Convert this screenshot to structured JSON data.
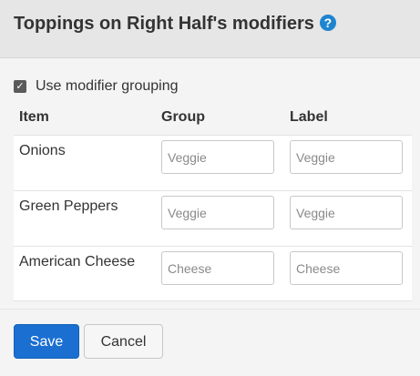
{
  "dialog": {
    "title": "Toppings on Right Half's modifiers",
    "help_icon": "?"
  },
  "grouping": {
    "checked": true,
    "label": "Use modifier grouping"
  },
  "table": {
    "headers": {
      "item": "Item",
      "group": "Group",
      "label": "Label"
    },
    "rows": [
      {
        "item": "Onions",
        "group_placeholder": "Veggie",
        "label_placeholder": "Veggie"
      },
      {
        "item": "Green Peppers",
        "group_placeholder": "Veggie",
        "label_placeholder": "Veggie"
      },
      {
        "item": "American Cheese",
        "group_placeholder": "Cheese",
        "label_placeholder": "Cheese"
      }
    ]
  },
  "actions": {
    "save_label": "Save",
    "cancel_label": "Cancel"
  },
  "colors": {
    "primary": "#1a6fd1",
    "help_icon": "#1e84d0",
    "header_bg": "#e6e6e6"
  },
  "icons": {
    "help": "help-icon",
    "checkbox": "checkmark-icon"
  }
}
